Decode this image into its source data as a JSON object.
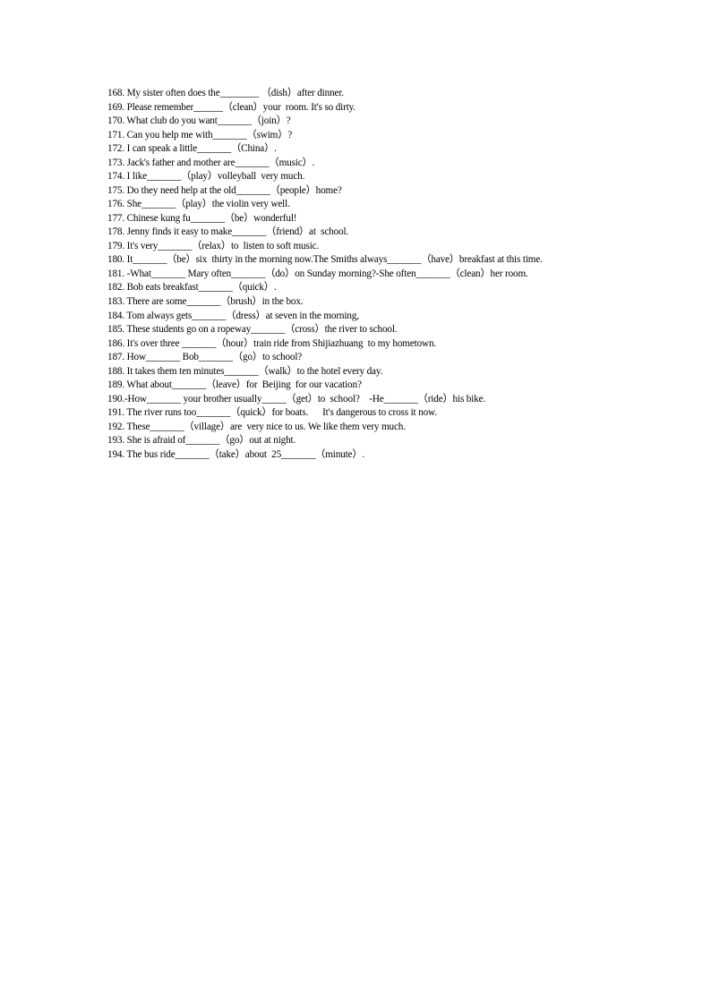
{
  "document": {
    "lines": [
      "168. My sister often does the________ （dish）after dinner.",
      "169. Please remember______（clean）your  room. It's so dirty.",
      "170. What club do you want_______（join）?",
      "171. Can you help me with_______（swim）?",
      "172. I can speak a little_______（China）.",
      "173. Jack's father and mother are_______（music）.",
      "174. I like_______（play）volleyball  very much.",
      "175. Do they need help at the old_______（people）home?",
      "176. She_______（play）the violin very well.",
      "177. Chinese kung fu_______（be）wonderful!",
      "178. Jenny finds it easy to make_______（friend）at  school.",
      "179. It's very_______（relax）to  listen to soft music.",
      "180. It_______（be）six  thirty in the morning now.The Smiths always_______（have）breakfast at this time.",
      "181. -What_______ Mary often_______（do）on Sunday morning?-She often_______（clean）her room.",
      "182. Bob eats breakfast_______（quick）.",
      "183. There are some_______（brush）in the box.",
      "184. Tom always gets_______（dress）at seven in the morning,",
      "185. These students go on a ropeway_______（cross）the river to school.",
      "186. It's over three _______（hour）train ride from Shijiazhuang  to my hometown.",
      "187. How_______ Bob_______（go）to school?",
      "188. It takes them ten minutes_______（walk）to the hotel every day.",
      "189. What about_______（leave）for  Beijing  for our vacation?",
      "190.-How_______ your brother usually_____（get）to  school?    -He_______（ride）his bike.",
      "191. The river runs too_______（quick）for boats.      It's dangerous to cross it now.",
      "192. These_______（village）are  very nice to us. We like them very much.",
      "193. She is afraid of_______（go）out at night.",
      "194. The bus ride_______（take）about  25_______（minute）."
    ]
  }
}
